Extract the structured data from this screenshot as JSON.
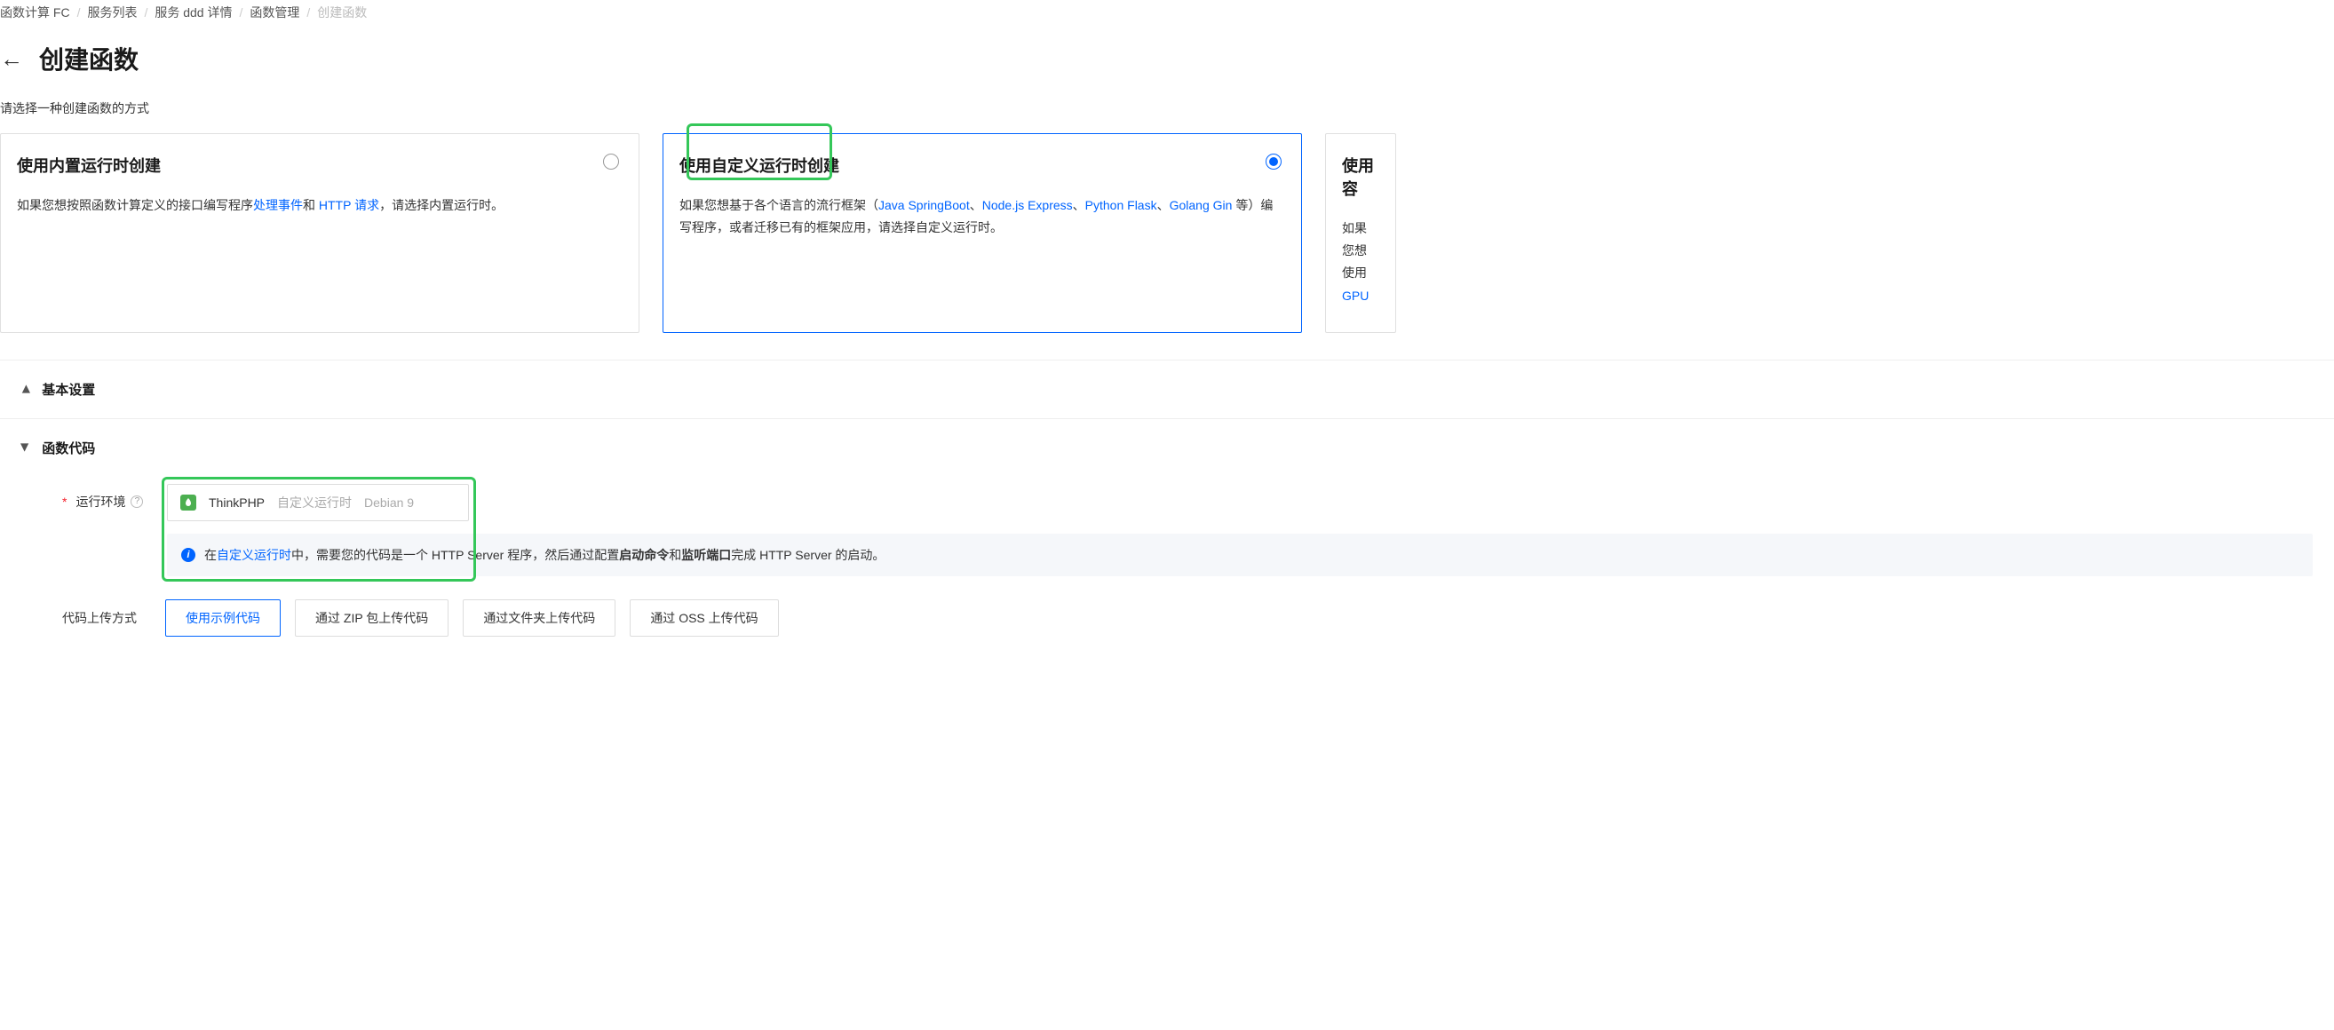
{
  "breadcrumb": {
    "items": [
      "函数计算 FC",
      "服务列表",
      "服务 ddd 详情",
      "函数管理"
    ],
    "current": "创建函数"
  },
  "page": {
    "title": "创建函数",
    "hint": "请选择一种创建函数的方式"
  },
  "cards": {
    "builtin": {
      "title": "使用内置运行时创建",
      "desc_pre": "如果您想按照函数计算定义的接口编写程序",
      "link1": "处理事件",
      "and": "和 ",
      "link2": "HTTP 请求",
      "desc_post": "，请选择内置运行时。"
    },
    "custom": {
      "title": "使用自定义运行时创建",
      "desc_pre": "如果您想基于各个语言的流行框架（",
      "link1": "Java SpringBoot",
      "sep": "、",
      "link2": "Node.js Express",
      "link3": "Python Flask",
      "link4": "Golang Gin",
      "desc_mid": " 等）编写程序，或者迁移已有的框架应用，请选择自定义运行时。"
    },
    "container": {
      "title": "使用容",
      "desc_pre": "如果您想",
      "desc_mid": "使用 ",
      "link1": "GPU"
    }
  },
  "sections": {
    "basic": "基本设置",
    "code": "函数代码"
  },
  "runtime": {
    "label": "运行环境",
    "name": "ThinkPHP",
    "sub1": "自定义运行时",
    "sub2": "Debian 9"
  },
  "info": {
    "pre": "在",
    "link": "自定义运行时",
    "mid1": "中，需要您的代码是一个 HTTP Server 程序，然后通过配置",
    "bold1": "启动命令",
    "mid2": "和",
    "bold2": "监听端口",
    "post": "完成 HTTP Server 的启动。"
  },
  "upload": {
    "label": "代码上传方式",
    "btn1": "使用示例代码",
    "btn2": "通过 ZIP 包上传代码",
    "btn3": "通过文件夹上传代码",
    "btn4": "通过 OSS 上传代码"
  }
}
